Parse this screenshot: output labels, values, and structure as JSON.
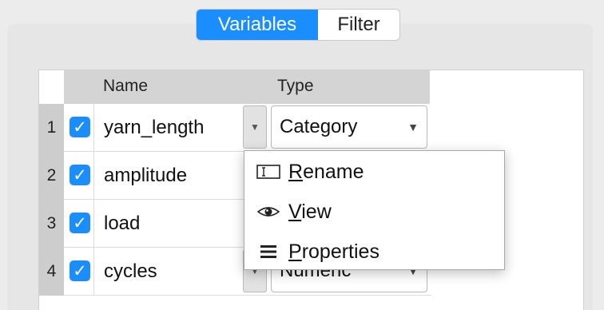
{
  "tabs": [
    {
      "label": "Variables",
      "active": true
    },
    {
      "label": "Filter",
      "active": false
    }
  ],
  "table": {
    "headers": {
      "name": "Name",
      "type": "Type"
    },
    "rows": [
      {
        "num": "1",
        "checked": true,
        "name": "yarn_length",
        "type": "Category"
      },
      {
        "num": "2",
        "checked": true,
        "name": "amplitude",
        "type": ""
      },
      {
        "num": "3",
        "checked": true,
        "name": "load",
        "type": ""
      },
      {
        "num": "4",
        "checked": true,
        "name": "cycles",
        "type": "Numeric"
      }
    ]
  },
  "context_menu": {
    "items": [
      {
        "icon": "rename-icon",
        "accel": "R",
        "rest": "ename"
      },
      {
        "icon": "eye-icon",
        "accel": "V",
        "rest": "iew"
      },
      {
        "icon": "list-icon",
        "accel": "P",
        "rest": "roperties"
      }
    ]
  },
  "colors": {
    "accent": "#1a8dff"
  }
}
